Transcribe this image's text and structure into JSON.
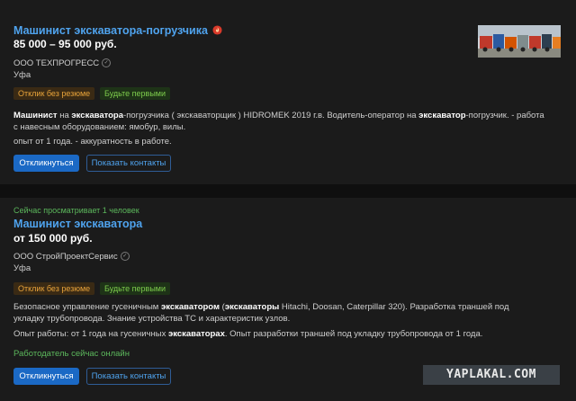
{
  "vacancies": [
    {
      "title": "Машинист экскаватора-погрузчика",
      "salary": "85 000 – 95 000 руб.",
      "company": "ООО ТЕХПРОГРЕСС",
      "city": "Уфа",
      "badges": [
        "Отклик без резюме",
        "Будьте первыми"
      ],
      "desc1_parts": [
        "Машинист",
        " на ",
        "экскаватора",
        "-погрузчика ( экскаваторщик ) HIDROMEK 2019 г.в. Водитель-оператор на ",
        "экскаватор",
        "-погрузчик. - работа с навесным оборудованием: ямобур, вилы."
      ],
      "desc2": "опыт от 1 года. - аккуратность в работе.",
      "respond_label": "Откликнуться",
      "contacts_label": "Показать контакты"
    },
    {
      "viewing": "Сейчас просматривает 1 человек",
      "title": "Машинист экскаватора",
      "salary": "от 150 000 руб.",
      "company": "ООО СтройПроектСервис",
      "city": "Уфа",
      "badges": [
        "Отклик без резюме",
        "Будьте первыми"
      ],
      "desc1_parts": [
        "Безопасное управление гусеничным ",
        "экскаватором",
        " (",
        "экскаваторы",
        " Hitachi, Doosan, Caterpillar 320). Разработка траншей под укладку трубопровода. Знание устройства ТС и характеристик узлов."
      ],
      "desc2_parts": [
        "Опыт работы: от 1 года на гусеничных ",
        "экскаваторах",
        ". Опыт разработки траншей под укладку трубопровода от 1 года."
      ],
      "online": "Работодатель сейчас онлайн",
      "respond_label": "Откликнуться",
      "contacts_label": "Показать контакты"
    }
  ],
  "watermark": "YAPLAKAL.COM",
  "icons": {
    "hot": "fire-icon",
    "verified": "verified-check-icon"
  },
  "colors": {
    "title": "#4fa3ee",
    "primary": "#1b69c5",
    "online": "#5cb85c",
    "badge_orange": "#e8a33a",
    "badge_green": "#7dcc4c"
  }
}
